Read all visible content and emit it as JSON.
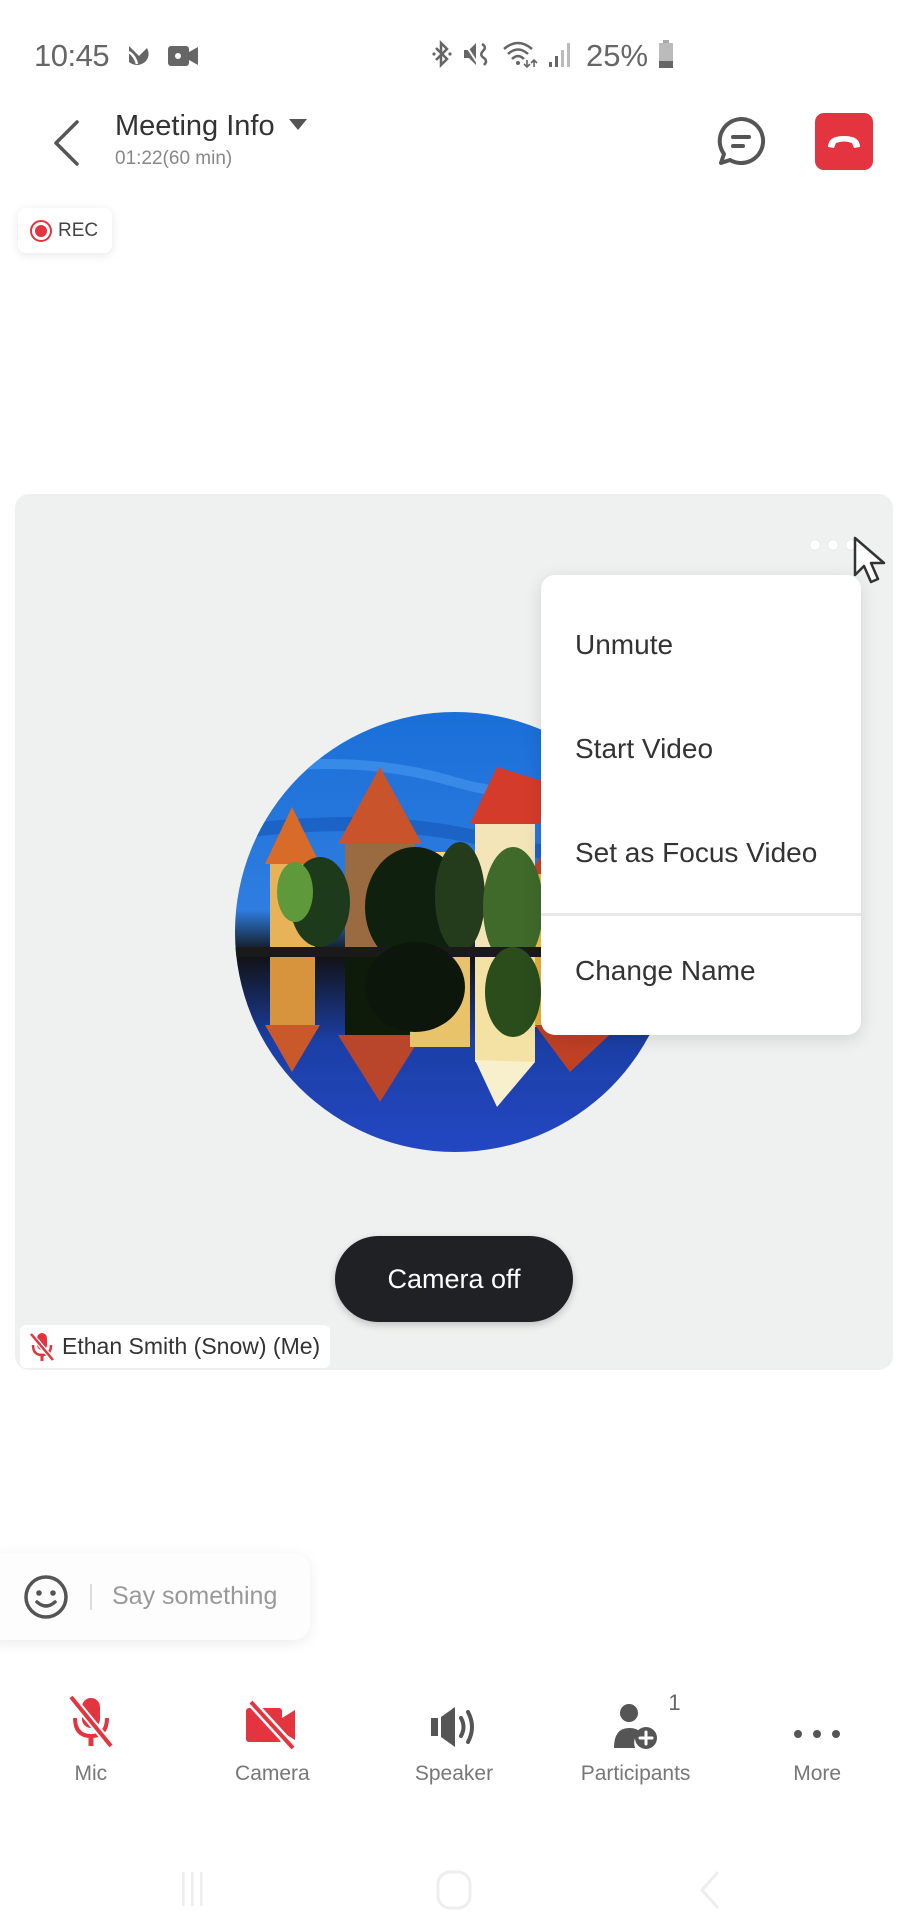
{
  "status_bar": {
    "time": "10:45",
    "left_icons": [
      "cast-icon",
      "video-recording-icon"
    ],
    "right_icons": [
      "bluetooth-icon",
      "mute-vibrate-icon",
      "wifi-icon",
      "signal-icon"
    ],
    "battery_percent": "25%",
    "battery_level": 0.25
  },
  "header": {
    "title": "Meeting Info",
    "subtitle": "01:22(60 min)",
    "end_call_color": "#e4343f"
  },
  "recording": {
    "label": "REC"
  },
  "video_tile": {
    "participant_name": "Ethan Smith (Snow) (Me)",
    "mic_muted": true,
    "toast": "Camera off"
  },
  "context_menu": {
    "items": [
      {
        "label": "Unmute"
      },
      {
        "label": "Start Video"
      },
      {
        "label": "Set as Focus Video"
      },
      {
        "label": "Change Name"
      }
    ]
  },
  "chat": {
    "placeholder": "Say something"
  },
  "toolbar": {
    "items": [
      {
        "label": "Mic",
        "icon": "mic-off-icon",
        "state": "off"
      },
      {
        "label": "Camera",
        "icon": "camera-off-icon",
        "state": "off"
      },
      {
        "label": "Speaker",
        "icon": "speaker-icon"
      },
      {
        "label": "Participants",
        "icon": "participants-icon",
        "count": "1"
      },
      {
        "label": "More",
        "icon": "more-icon"
      }
    ]
  },
  "colors": {
    "accent_red": "#e4343f",
    "icon_gray": "#555555",
    "tile_bg": "#eff1f0"
  }
}
